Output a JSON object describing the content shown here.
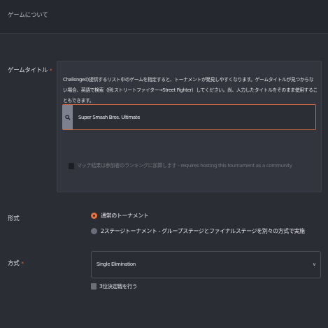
{
  "header": {
    "title": "ゲームについて"
  },
  "game": {
    "label": "ゲームタイトル",
    "required_mark": "*",
    "description": "Challongeの提供するリスト中のゲームを指定すると、トーナメントが発見しやすくなります。ゲームタイトルが見つからない場合、英語で検索（例:ストリートファイター→Street Fighter）してください。尚、入力したタイトルをそのまま使用することもできます。",
    "search_icon": "search-icon",
    "search_value": "Super Smash Bros. Ultimate",
    "ranking_checkbox_label": "マッチ結果は参加者のランキングに加算します - requires hosting this tournament as a community"
  },
  "format": {
    "label": "形式",
    "options": [
      {
        "label": "通常のトーナメント",
        "selected": true
      },
      {
        "label": "2ステージトーナメント - グループステージとファイナルステージを別々の方式で実施",
        "selected": false
      }
    ]
  },
  "method": {
    "label": "方式",
    "required_mark": "*",
    "selected": "Single Elimination",
    "third_place_label": "3位決定戦を行う"
  },
  "colors": {
    "accent": "#e8743b",
    "background": "#2b2d35",
    "panel": "#33353e"
  }
}
